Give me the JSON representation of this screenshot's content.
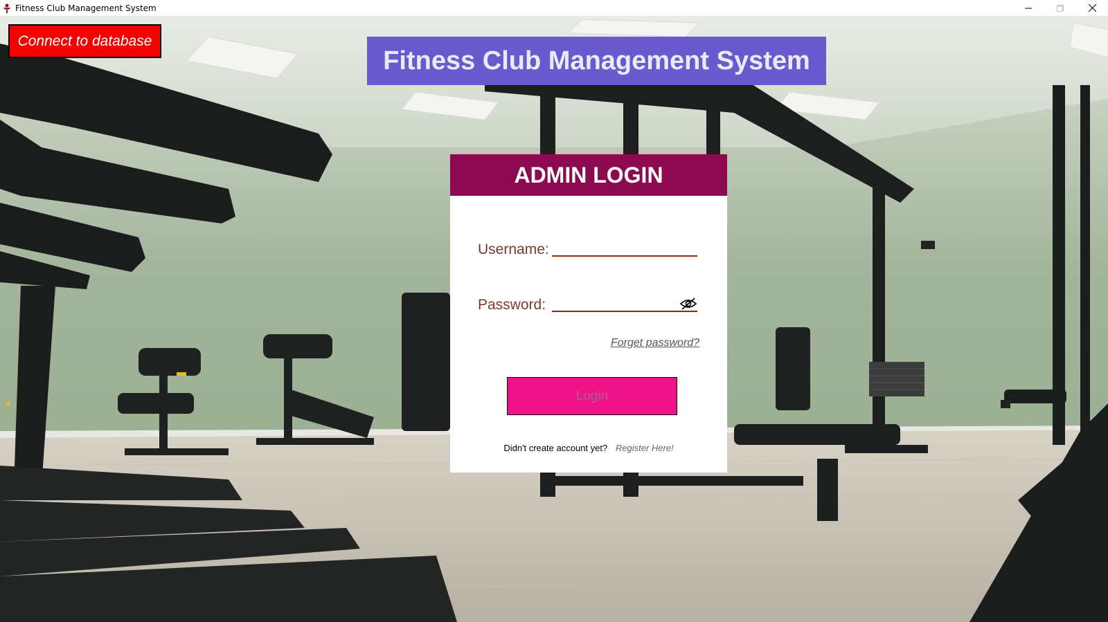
{
  "window": {
    "title": "Fitness Club Management System",
    "icon": "app-logo-icon",
    "controls": [
      "minimize-icon",
      "maximize-icon",
      "close-icon"
    ]
  },
  "connect_button": {
    "label": "Connect to database",
    "color": "#f40000"
  },
  "app_title": {
    "text": "Fitness Club Management System",
    "color": "#6a5acd"
  },
  "login": {
    "header": "ADMIN LOGIN",
    "header_color": "#8b0a50",
    "username_label": "Username:",
    "username_value": "",
    "password_label": "Password:",
    "password_value": "",
    "password_toggle_icon": "eye-slash-icon",
    "forget_password": "Forget password?",
    "login_button": "Login",
    "login_button_color": "#ec1488",
    "register_prompt": "Didn't create account yet?",
    "register_link": "Register Here!"
  },
  "background": {
    "description_icon": "gym-background-image"
  }
}
